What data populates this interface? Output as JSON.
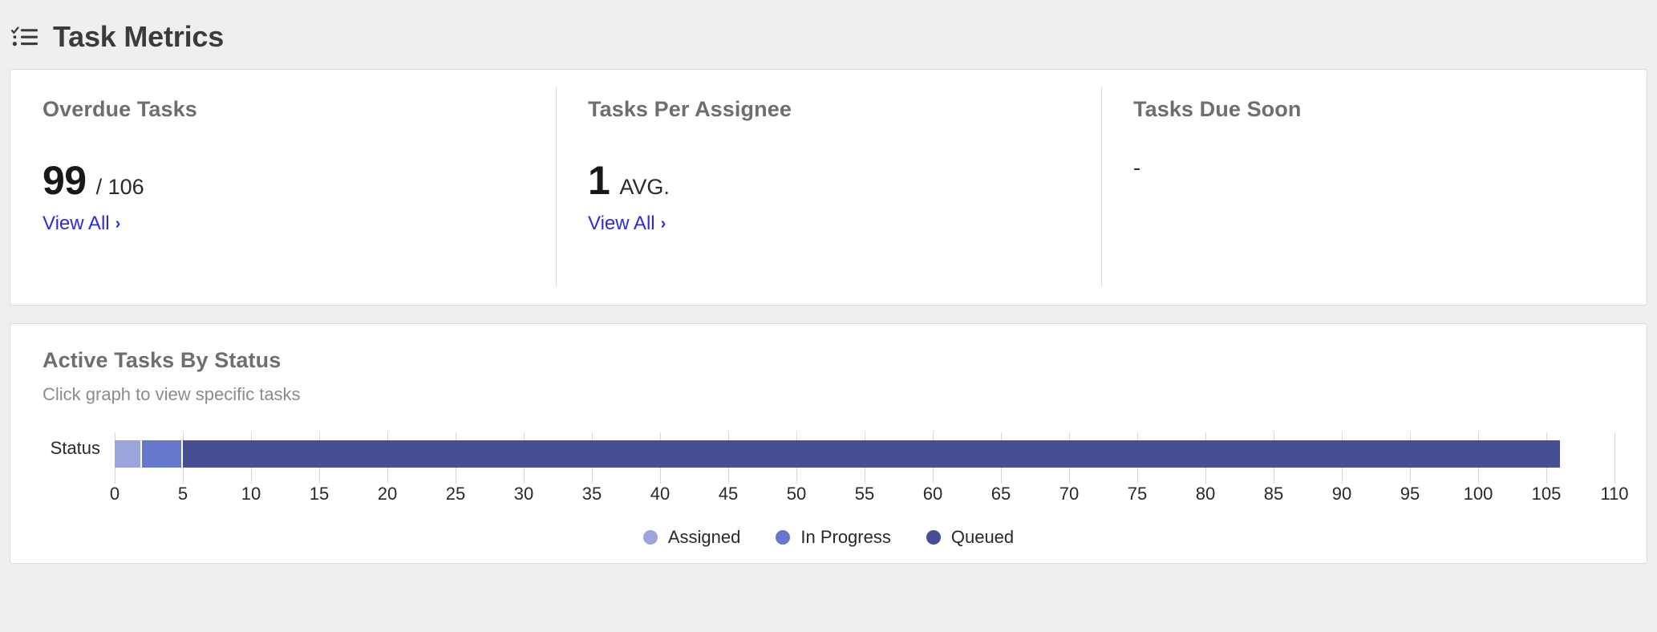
{
  "header": {
    "title": "Task Metrics",
    "icon": "checklist-icon"
  },
  "kpis": [
    {
      "title": "Overdue Tasks",
      "value": "99",
      "suffix": "/ 106",
      "link_label": "View All",
      "link_chevron": "›",
      "has_link": true
    },
    {
      "title": "Tasks Per Assignee",
      "value": "1",
      "suffix": "AVG.",
      "link_label": "View All",
      "link_chevron": "›",
      "has_link": true
    },
    {
      "title": "Tasks Due Soon",
      "value": "-",
      "suffix": "",
      "link_label": "",
      "link_chevron": "",
      "has_link": false
    }
  ],
  "chart_panel": {
    "title": "Active Tasks By Status",
    "subtitle": "Click graph to view specific tasks"
  },
  "chart_data": {
    "type": "bar",
    "orientation": "horizontal",
    "stacked": true,
    "title": "Active Tasks By Status",
    "subtitle": "Click graph to view specific tasks",
    "xlabel": "",
    "ylabel": "Status",
    "categories": [
      "Status"
    ],
    "series": [
      {
        "name": "Assigned",
        "values": [
          2
        ],
        "color": "#9ba4dd"
      },
      {
        "name": "In Progress",
        "values": [
          3
        ],
        "color": "#6678cc"
      },
      {
        "name": "Queued",
        "values": [
          101
        ],
        "color": "#474f92"
      }
    ],
    "total": 106,
    "xlim": [
      0,
      110
    ],
    "xticks": [
      0,
      5,
      10,
      15,
      20,
      25,
      30,
      35,
      40,
      45,
      50,
      55,
      60,
      65,
      70,
      75,
      80,
      85,
      90,
      95,
      100,
      105,
      110
    ],
    "grid": true,
    "legend_position": "bottom"
  },
  "colors": {
    "page_background": "#efefef",
    "card_background": "#ffffff",
    "card_border": "#dddbda",
    "title_text": "#3b3b3b",
    "muted_heading": "#706e6b",
    "body_text": "#2b2826",
    "subtitle_text": "#8b8b8b",
    "link": "#2b2bdd",
    "assigned": "#9ba4dd",
    "in_progress": "#6678cc",
    "queued": "#474f92",
    "gridline": "#d8d8d8"
  }
}
